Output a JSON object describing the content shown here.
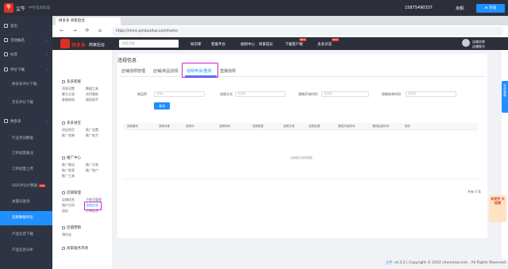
{
  "topbar": {
    "brand": "尘牛",
    "brand_sub": "中控电商助理",
    "phone": "15875490337",
    "balance_label": "余额:",
    "recharge": "充值",
    "recharge_icon": "plus-icon"
  },
  "sidebar": {
    "items": [
      {
        "label": "首页",
        "icon": "home-icon"
      },
      {
        "label": "活动报名",
        "icon": "calendar-icon"
      },
      {
        "label": "抖音",
        "icon": "douyin-icon"
      },
      {
        "label": "评价下载",
        "icon": "download-icon"
      },
      {
        "label": "拼多多评价下载",
        "icon": ""
      },
      {
        "label": "京东评价下载",
        "icon": ""
      },
      {
        "label": "拼多多",
        "icon": "pdd-icon"
      },
      {
        "label": "行业热词数据",
        "icon": ""
      },
      {
        "label": "订单批量备注",
        "icon": ""
      },
      {
        "label": "订单批量上传",
        "icon": ""
      },
      {
        "label": "DSR评分计算器",
        "icon": "",
        "badge": "new"
      },
      {
        "label": "关键词查询",
        "icon": ""
      },
      {
        "label": "违规数据导出",
        "icon": ""
      },
      {
        "label": "产品信息下载",
        "icon": ""
      },
      {
        "label": "产品信息分析",
        "icon": ""
      }
    ]
  },
  "browser": {
    "tab_title": "拼多多 商家后台",
    "url": "https://mms.pinduoduo.com/home",
    "back": "←",
    "forward": "→",
    "reload": "⟳",
    "home": "⌂"
  },
  "pdd_header": {
    "name": "拼多多",
    "sub": "商家后台",
    "search_placeholder": "搜索功能",
    "nav": [
      "知识库",
      "客服平台",
      "规则中心",
      "商家成长",
      "下载客户端",
      "多多买菜"
    ],
    "nav_badges": [
      "",
      "",
      "",
      "",
      "NEW",
      "NEW"
    ],
    "shop_line1": "店铺名称",
    "shop_line2": "店铺账号"
  },
  "menu": {
    "groups": [
      {
        "title": "多多客服",
        "icon": "chat-icon",
        "links": [
          "消息设置",
          "数据工具",
          "聊天记录",
          "实时看板",
          "客服绩效",
          "服务助手"
        ]
      },
      {
        "title": "多多进宝",
        "icon": "gift-icon",
        "links": [
          "进宝首页",
          "推广设置",
          "推广效果",
          "推广助力"
        ]
      },
      {
        "title": "推广中心",
        "icon": "megaphone-icon",
        "links": [
          "推广概况",
          "推广计划",
          "推广报表",
          "推广账户",
          "推广工具"
        ]
      },
      {
        "title": "店铺管理",
        "icon": "store-icon",
        "links": [
          "店铺信息",
          "子账号管理",
          "图片空间",
          "违规信息",
          "退店",
          "订单综合"
        ]
      },
      {
        "title": "店铺营销",
        "icon": "tag-icon",
        "links": [
          "锦内宝"
        ]
      },
      {
        "title": "商家服务市场",
        "icon": "heart-icon",
        "links": []
      }
    ]
  },
  "page": {
    "title": "违规信息",
    "tabs": [
      "店铺违规管理",
      "店铺/商品违规",
      "违规申诉/整改",
      "直播违规"
    ],
    "active_tab": 2,
    "filters": {
      "item_id_label": "商品ID",
      "item_id_placeholder": "请输入",
      "violation_type_label": "违规方式",
      "violation_type_placeholder": "请选择",
      "violation_start_label": "限制开始时间",
      "violation_start_placeholder": "请选择",
      "violation_end_label": "限制结束时间",
      "violation_end_placeholder": "请选择"
    },
    "query_button": "查询",
    "table_headers": [
      "违规编号",
      "违规对象",
      "违规ID",
      "违规时间",
      "违规类型",
      "违规方案",
      "违规处理",
      "限制开始时间",
      "限制结束时间",
      "操作"
    ],
    "empty_text": "店铺暂无违规数据",
    "total_text": "共有 0 条"
  },
  "footer": {
    "brand": "尘牛",
    "text": "v4.3.2 | Copyright © 2022 chenniew.com . All Rights Reserved."
  },
  "right_float": {
    "label": "在线客服"
  },
  "promo": {
    "text": "年货节 大促销"
  },
  "colors": {
    "accent": "#1e90ff",
    "brand_red": "#e02e24",
    "highlight": "#d020d8",
    "sidebar_bg": "#2e3443"
  }
}
